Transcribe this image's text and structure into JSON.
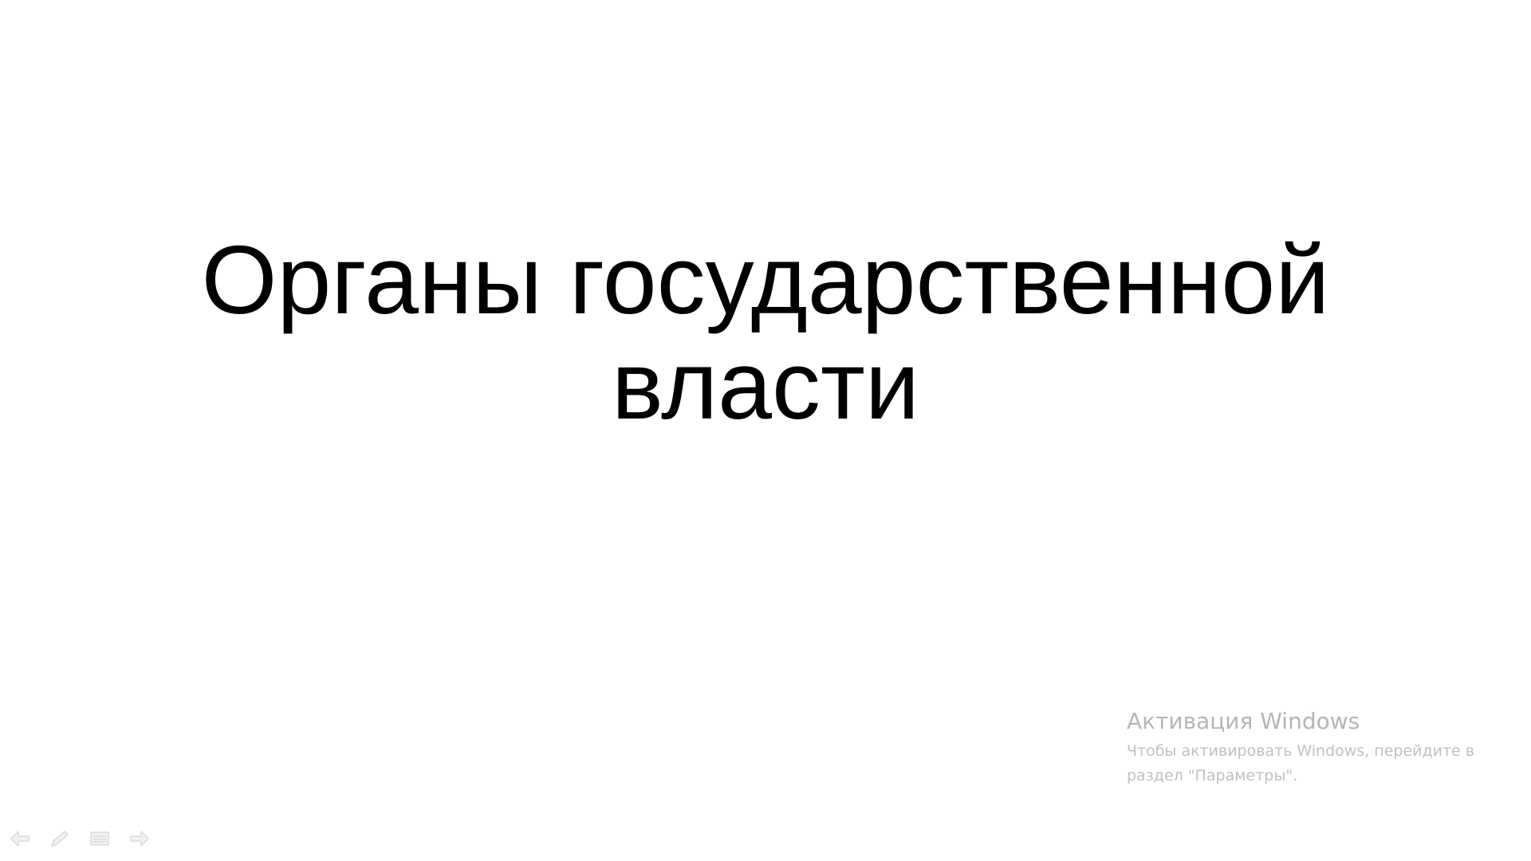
{
  "slide": {
    "title_line1": "Органы государственной",
    "title_line2": "власти"
  },
  "watermark": {
    "title": "Активация Windows",
    "text": "Чтобы активировать Windows, перейдите в раздел \"Параметры\"."
  },
  "toolbar": {
    "icons": [
      "previous-arrow-icon",
      "pen-icon",
      "menu-icon",
      "next-arrow-icon"
    ]
  },
  "colors": {
    "background": "#ffffff",
    "title": "#000000",
    "watermark": "#bdbdbd",
    "toolbar_icon": "#cfcfcf"
  }
}
